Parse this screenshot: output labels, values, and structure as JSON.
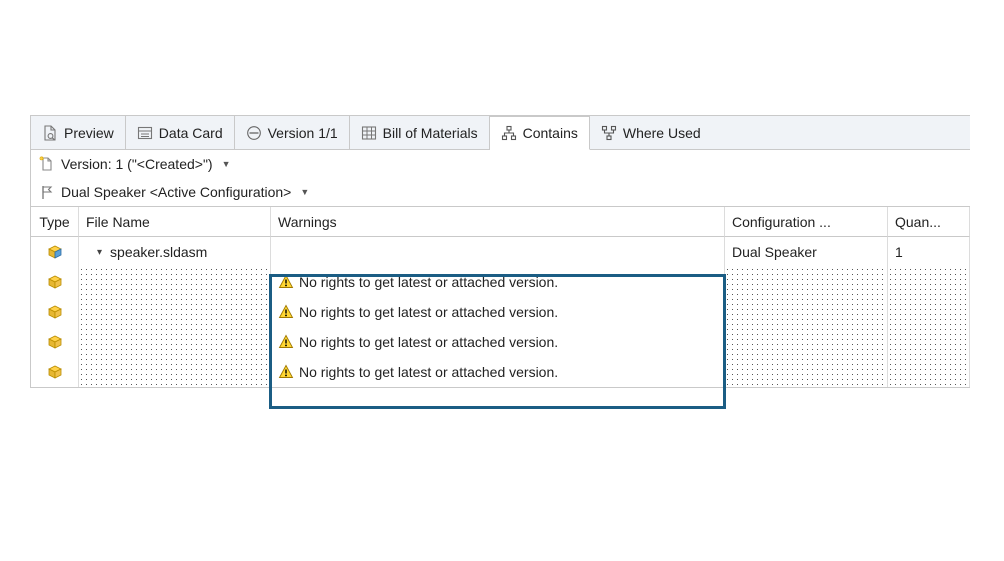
{
  "tabs": [
    {
      "label": "Preview"
    },
    {
      "label": "Data Card"
    },
    {
      "label": "Version 1/1"
    },
    {
      "label": "Bill of Materials"
    },
    {
      "label": "Contains",
      "active": true
    },
    {
      "label": "Where Used"
    }
  ],
  "version_selector": "Version: 1 (\"<Created>\")",
  "config_selector": "Dual Speaker <Active Configuration>",
  "columns": {
    "type": "Type",
    "file": "File Name",
    "warn": "Warnings",
    "cfg": "Configuration ...",
    "qty": "Quan..."
  },
  "rows": [
    {
      "file": "speaker.sldasm",
      "warn": "",
      "cfg": "Dual Speaker",
      "qty": "1"
    },
    {
      "file": "",
      "warn": "No rights to get latest or attached version.",
      "cfg": "",
      "qty": ""
    },
    {
      "file": "",
      "warn": "No rights to get latest or attached version.",
      "cfg": "",
      "qty": ""
    },
    {
      "file": "",
      "warn": "No rights to get latest or attached version.",
      "cfg": "",
      "qty": ""
    },
    {
      "file": "",
      "warn": "No rights to get latest or attached version.",
      "cfg": "",
      "qty": ""
    }
  ]
}
